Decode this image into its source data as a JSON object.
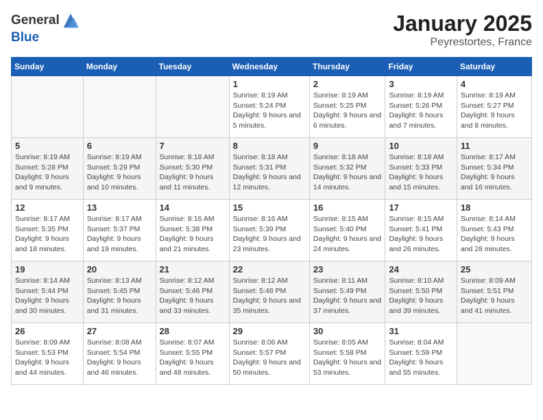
{
  "header": {
    "logo_general": "General",
    "logo_blue": "Blue",
    "title": "January 2025",
    "subtitle": "Peyrestortes, France"
  },
  "weekdays": [
    "Sunday",
    "Monday",
    "Tuesday",
    "Wednesday",
    "Thursday",
    "Friday",
    "Saturday"
  ],
  "weeks": [
    [
      {
        "day": "",
        "text": ""
      },
      {
        "day": "",
        "text": ""
      },
      {
        "day": "",
        "text": ""
      },
      {
        "day": "1",
        "text": "Sunrise: 8:19 AM\nSunset: 5:24 PM\nDaylight: 9 hours and 5 minutes."
      },
      {
        "day": "2",
        "text": "Sunrise: 8:19 AM\nSunset: 5:25 PM\nDaylight: 9 hours and 6 minutes."
      },
      {
        "day": "3",
        "text": "Sunrise: 8:19 AM\nSunset: 5:26 PM\nDaylight: 9 hours and 7 minutes."
      },
      {
        "day": "4",
        "text": "Sunrise: 8:19 AM\nSunset: 5:27 PM\nDaylight: 9 hours and 8 minutes."
      }
    ],
    [
      {
        "day": "5",
        "text": "Sunrise: 8:19 AM\nSunset: 5:28 PM\nDaylight: 9 hours and 9 minutes."
      },
      {
        "day": "6",
        "text": "Sunrise: 8:19 AM\nSunset: 5:29 PM\nDaylight: 9 hours and 10 minutes."
      },
      {
        "day": "7",
        "text": "Sunrise: 8:18 AM\nSunset: 5:30 PM\nDaylight: 9 hours and 11 minutes."
      },
      {
        "day": "8",
        "text": "Sunrise: 8:18 AM\nSunset: 5:31 PM\nDaylight: 9 hours and 12 minutes."
      },
      {
        "day": "9",
        "text": "Sunrise: 8:18 AM\nSunset: 5:32 PM\nDaylight: 9 hours and 14 minutes."
      },
      {
        "day": "10",
        "text": "Sunrise: 8:18 AM\nSunset: 5:33 PM\nDaylight: 9 hours and 15 minutes."
      },
      {
        "day": "11",
        "text": "Sunrise: 8:17 AM\nSunset: 5:34 PM\nDaylight: 9 hours and 16 minutes."
      }
    ],
    [
      {
        "day": "12",
        "text": "Sunrise: 8:17 AM\nSunset: 5:35 PM\nDaylight: 9 hours and 18 minutes."
      },
      {
        "day": "13",
        "text": "Sunrise: 8:17 AM\nSunset: 5:37 PM\nDaylight: 9 hours and 19 minutes."
      },
      {
        "day": "14",
        "text": "Sunrise: 8:16 AM\nSunset: 5:38 PM\nDaylight: 9 hours and 21 minutes."
      },
      {
        "day": "15",
        "text": "Sunrise: 8:16 AM\nSunset: 5:39 PM\nDaylight: 9 hours and 23 minutes."
      },
      {
        "day": "16",
        "text": "Sunrise: 8:15 AM\nSunset: 5:40 PM\nDaylight: 9 hours and 24 minutes."
      },
      {
        "day": "17",
        "text": "Sunrise: 8:15 AM\nSunset: 5:41 PM\nDaylight: 9 hours and 26 minutes."
      },
      {
        "day": "18",
        "text": "Sunrise: 8:14 AM\nSunset: 5:43 PM\nDaylight: 9 hours and 28 minutes."
      }
    ],
    [
      {
        "day": "19",
        "text": "Sunrise: 8:14 AM\nSunset: 5:44 PM\nDaylight: 9 hours and 30 minutes."
      },
      {
        "day": "20",
        "text": "Sunrise: 8:13 AM\nSunset: 5:45 PM\nDaylight: 9 hours and 31 minutes."
      },
      {
        "day": "21",
        "text": "Sunrise: 8:12 AM\nSunset: 5:46 PM\nDaylight: 9 hours and 33 minutes."
      },
      {
        "day": "22",
        "text": "Sunrise: 8:12 AM\nSunset: 5:48 PM\nDaylight: 9 hours and 35 minutes."
      },
      {
        "day": "23",
        "text": "Sunrise: 8:11 AM\nSunset: 5:49 PM\nDaylight: 9 hours and 37 minutes."
      },
      {
        "day": "24",
        "text": "Sunrise: 8:10 AM\nSunset: 5:50 PM\nDaylight: 9 hours and 39 minutes."
      },
      {
        "day": "25",
        "text": "Sunrise: 8:09 AM\nSunset: 5:51 PM\nDaylight: 9 hours and 41 minutes."
      }
    ],
    [
      {
        "day": "26",
        "text": "Sunrise: 8:09 AM\nSunset: 5:53 PM\nDaylight: 9 hours and 44 minutes."
      },
      {
        "day": "27",
        "text": "Sunrise: 8:08 AM\nSunset: 5:54 PM\nDaylight: 9 hours and 46 minutes."
      },
      {
        "day": "28",
        "text": "Sunrise: 8:07 AM\nSunset: 5:55 PM\nDaylight: 9 hours and 48 minutes."
      },
      {
        "day": "29",
        "text": "Sunrise: 8:06 AM\nSunset: 5:57 PM\nDaylight: 9 hours and 50 minutes."
      },
      {
        "day": "30",
        "text": "Sunrise: 8:05 AM\nSunset: 5:58 PM\nDaylight: 9 hours and 53 minutes."
      },
      {
        "day": "31",
        "text": "Sunrise: 8:04 AM\nSunset: 5:59 PM\nDaylight: 9 hours and 55 minutes."
      },
      {
        "day": "",
        "text": ""
      }
    ]
  ]
}
